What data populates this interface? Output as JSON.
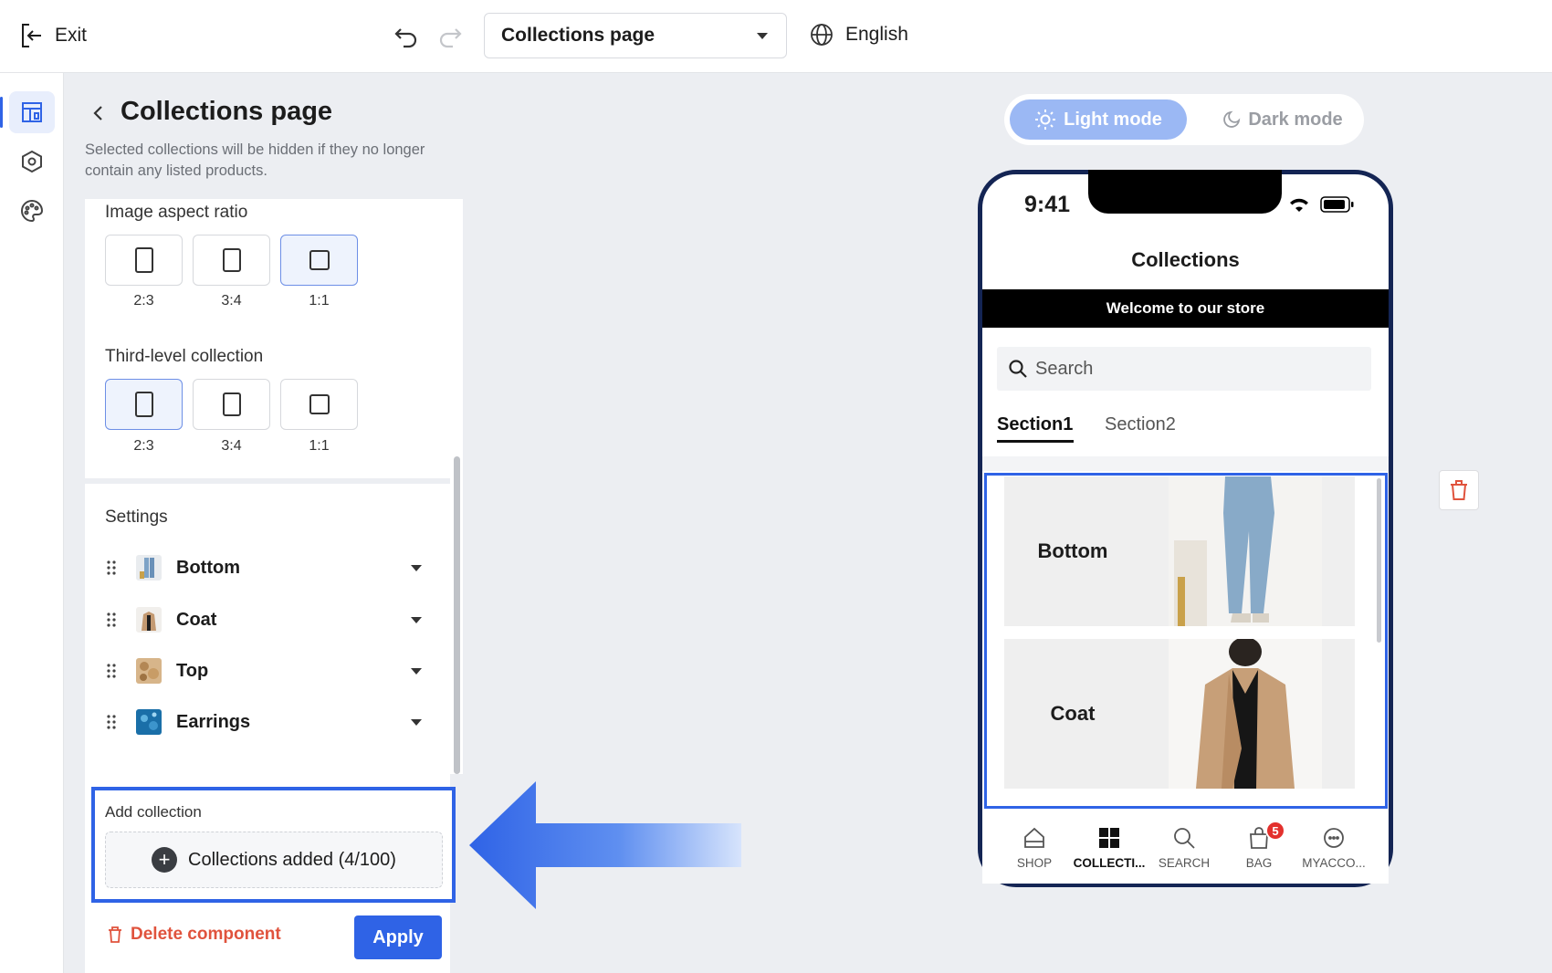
{
  "topbar": {
    "exit_label": "Exit",
    "page_select": "Collections page",
    "language": "English"
  },
  "panel": {
    "title": "Collections page",
    "description": "Selected collections will be hidden if they no longer contain any listed products.",
    "image_aspect_ratio_label": "Image aspect ratio",
    "image_aspect_ratios": [
      "2:3",
      "3:4",
      "1:1"
    ],
    "image_aspect_selected": "1:1",
    "third_level_label": "Third-level collection",
    "third_level_ratios": [
      "2:3",
      "3:4",
      "1:1"
    ],
    "third_level_selected": "2:3",
    "settings_title": "Settings",
    "collections": [
      {
        "name": "Bottom"
      },
      {
        "name": "Coat"
      },
      {
        "name": "Top"
      },
      {
        "name": "Earrings"
      }
    ],
    "add_collection_label": "Add collection",
    "add_collection_button": "Collections added (4/100)",
    "delete_label": "Delete component",
    "apply_label": "Apply"
  },
  "preview": {
    "light_mode": "Light mode",
    "dark_mode": "Dark mode",
    "time": "9:41",
    "title": "Collections",
    "welcome": "Welcome to our store",
    "search_placeholder": "Search",
    "tabs": [
      "Section1",
      "Section2"
    ],
    "cards": [
      {
        "label": "Bottom"
      },
      {
        "label": "Coat"
      }
    ],
    "nav": [
      "SHOP",
      "COLLECTI...",
      "SEARCH",
      "BAG",
      "MYACCO..."
    ],
    "bag_count": "5"
  },
  "colors": {
    "accent": "#2f63e6",
    "danger": "#e0533d",
    "phone_frame": "#142554"
  }
}
